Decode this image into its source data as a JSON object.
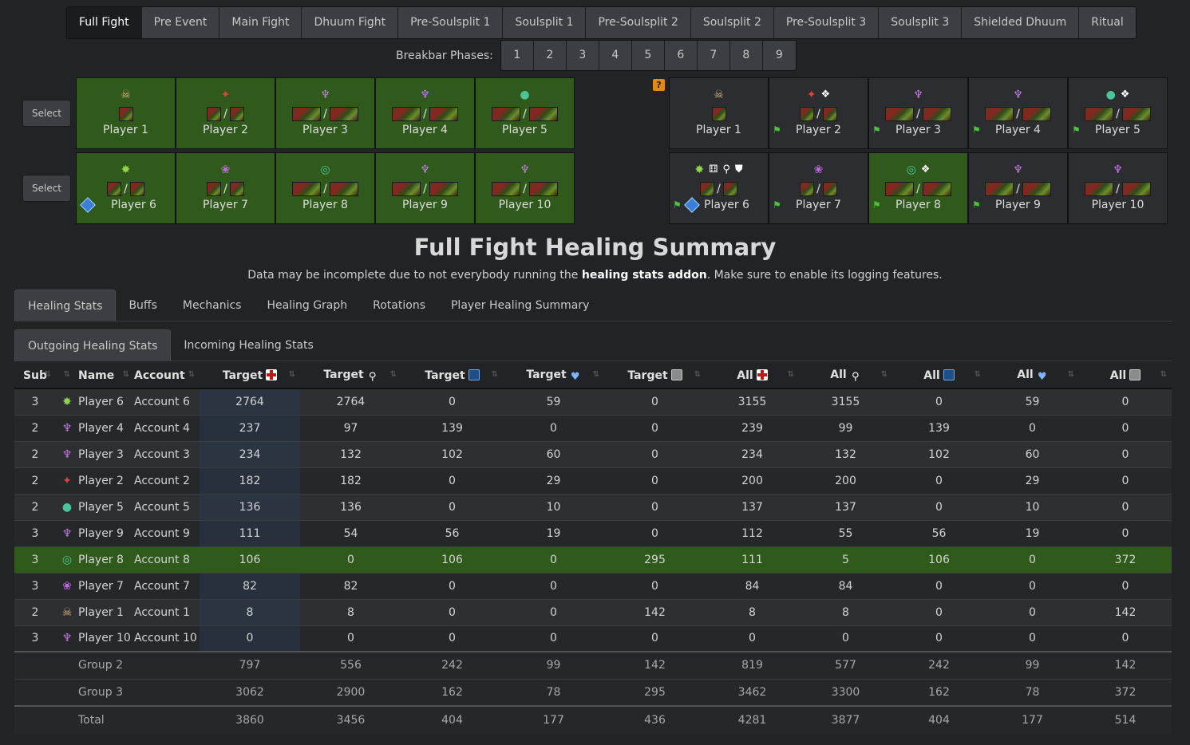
{
  "phases": [
    "Full Fight",
    "Pre Event",
    "Main Fight",
    "Dhuum Fight",
    "Pre-Soulsplit 1",
    "Soulsplit 1",
    "Pre-Soulsplit 2",
    "Soulsplit 2",
    "Pre-Soulsplit 3",
    "Soulsplit 3",
    "Shielded Dhuum",
    "Ritual"
  ],
  "active_phase": "Full Fight",
  "breakbar": {
    "label": "Breakbar Phases:",
    "buttons": [
      "1",
      "2",
      "3",
      "4",
      "5",
      "6",
      "7",
      "8",
      "9"
    ]
  },
  "select_label": "Select",
  "left_grid": [
    {
      "name": "Player 1",
      "prof_icon": "scourge-icon"
    },
    {
      "name": "Player 2",
      "prof_icon": "berserker-icon"
    },
    {
      "name": "Player 3",
      "prof_icon": "chronomancer-icon"
    },
    {
      "name": "Player 4",
      "prof_icon": "chronomancer-icon"
    },
    {
      "name": "Player 5",
      "prof_icon": "druid-icon"
    },
    {
      "name": "Player 6",
      "prof_icon": "soulbeast-icon"
    },
    {
      "name": "Player 7",
      "prof_icon": "mirage-icon"
    },
    {
      "name": "Player 8",
      "prof_icon": "tempest-icon"
    },
    {
      "name": "Player 9",
      "prof_icon": "chronomancer-icon"
    },
    {
      "name": "Player 10",
      "prof_icon": "chronomancer-icon"
    }
  ],
  "right_grid": [
    {
      "name": "Player 1",
      "prof_icon": "scourge-icon"
    },
    {
      "name": "Player 2",
      "prof_icon": "berserker-icon"
    },
    {
      "name": "Player 3",
      "prof_icon": "chronomancer-icon"
    },
    {
      "name": "Player 4",
      "prof_icon": "chronomancer-icon"
    },
    {
      "name": "Player 5",
      "prof_icon": "druid-icon"
    },
    {
      "name": "Player 6",
      "prof_icon": "soulbeast-icon"
    },
    {
      "name": "Player 7",
      "prof_icon": "mirage-icon"
    },
    {
      "name": "Player 8",
      "prof_icon": "tempest-icon"
    },
    {
      "name": "Player 9",
      "prof_icon": "chronomancer-icon"
    },
    {
      "name": "Player 10",
      "prof_icon": "chronomancer-icon"
    }
  ],
  "help_icon": "?",
  "title": "Full Fight Healing Summary",
  "subtitle": {
    "before": "Data may be incomplete due to not everybody running the ",
    "bold": "healing stats addon",
    "after": ". Make sure to enable its logging features."
  },
  "main_tabs": [
    "Healing Stats",
    "Buffs",
    "Mechanics",
    "Healing Graph",
    "Rotations",
    "Player Healing Summary"
  ],
  "inner_tabs": [
    "Outgoing Healing Stats",
    "Incoming Healing Stats"
  ],
  "table": {
    "headers": {
      "sub": "Sub",
      "name": "Name",
      "account": "Account",
      "target": "Target",
      "all": "All"
    },
    "rows": [
      {
        "sub": "3",
        "name": "Player 6",
        "account": "Account 6",
        "vals": [
          "2764",
          "2764",
          "0",
          "59",
          "0",
          "3155",
          "3155",
          "0",
          "59",
          "0"
        ],
        "prof": "soulbeast-icon",
        "highlight": false
      },
      {
        "sub": "2",
        "name": "Player 4",
        "account": "Account 4",
        "vals": [
          "237",
          "97",
          "139",
          "0",
          "0",
          "239",
          "99",
          "139",
          "0",
          "0"
        ],
        "prof": "chronomancer-icon",
        "highlight": false
      },
      {
        "sub": "2",
        "name": "Player 3",
        "account": "Account 3",
        "vals": [
          "234",
          "132",
          "102",
          "60",
          "0",
          "234",
          "132",
          "102",
          "60",
          "0"
        ],
        "prof": "chronomancer-icon",
        "highlight": false
      },
      {
        "sub": "2",
        "name": "Player 2",
        "account": "Account 2",
        "vals": [
          "182",
          "182",
          "0",
          "29",
          "0",
          "200",
          "200",
          "0",
          "29",
          "0"
        ],
        "prof": "berserker-icon",
        "highlight": false
      },
      {
        "sub": "2",
        "name": "Player 5",
        "account": "Account 5",
        "vals": [
          "136",
          "136",
          "0",
          "10",
          "0",
          "137",
          "137",
          "0",
          "10",
          "0"
        ],
        "prof": "druid-icon",
        "highlight": false
      },
      {
        "sub": "3",
        "name": "Player 9",
        "account": "Account 9",
        "vals": [
          "111",
          "54",
          "56",
          "19",
          "0",
          "112",
          "55",
          "56",
          "19",
          "0"
        ],
        "prof": "chronomancer-icon",
        "highlight": false
      },
      {
        "sub": "3",
        "name": "Player 8",
        "account": "Account 8",
        "vals": [
          "106",
          "0",
          "106",
          "0",
          "295",
          "111",
          "5",
          "106",
          "0",
          "372"
        ],
        "prof": "tempest-icon",
        "highlight": true
      },
      {
        "sub": "3",
        "name": "Player 7",
        "account": "Account 7",
        "vals": [
          "82",
          "82",
          "0",
          "0",
          "0",
          "84",
          "84",
          "0",
          "0",
          "0"
        ],
        "prof": "mirage-icon",
        "highlight": false
      },
      {
        "sub": "2",
        "name": "Player 1",
        "account": "Account 1",
        "vals": [
          "8",
          "8",
          "0",
          "0",
          "142",
          "8",
          "8",
          "0",
          "0",
          "142"
        ],
        "prof": "scourge-icon",
        "highlight": false
      },
      {
        "sub": "3",
        "name": "Player 10",
        "account": "Account 10",
        "vals": [
          "0",
          "0",
          "0",
          "0",
          "0",
          "0",
          "0",
          "0",
          "0",
          "0"
        ],
        "prof": "chronomancer-icon",
        "highlight": false
      }
    ],
    "footer": [
      {
        "label": "Group 2",
        "vals": [
          "797",
          "556",
          "242",
          "99",
          "142",
          "819",
          "577",
          "242",
          "99",
          "142"
        ]
      },
      {
        "label": "Group 3",
        "vals": [
          "3062",
          "2900",
          "162",
          "78",
          "295",
          "3462",
          "3300",
          "162",
          "78",
          "372"
        ]
      },
      {
        "label": "Total",
        "vals": [
          "3860",
          "3456",
          "404",
          "177",
          "436",
          "4281",
          "3877",
          "404",
          "177",
          "514"
        ]
      }
    ]
  }
}
